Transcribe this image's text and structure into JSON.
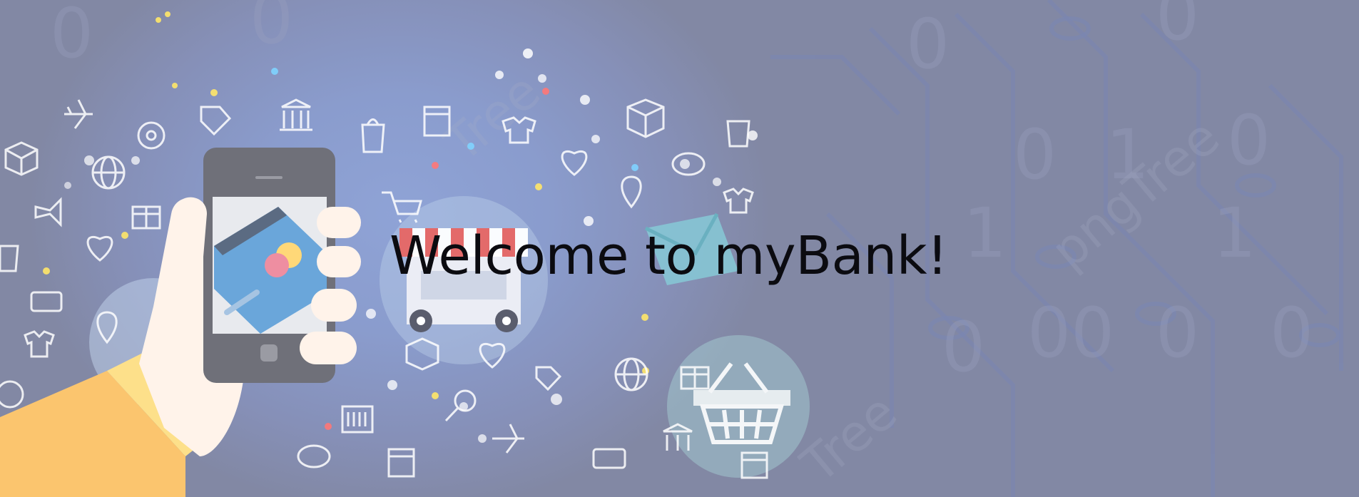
{
  "hero": {
    "heading": "Welcome to myBank!"
  },
  "icons": [
    "phone-in-hand-icon",
    "credit-card-icon",
    "shop-awning-icon",
    "shopping-basket-icon",
    "envelope-icon",
    "gift-icon",
    "globe-icon",
    "heart-icon",
    "airplane-icon",
    "shopping-bag-icon",
    "location-pin-icon",
    "piggy-bank-icon",
    "barcode-icon",
    "tag-icon",
    "bank-building-icon",
    "t-shirt-icon",
    "package-box-icon",
    "megaphone-icon",
    "shopping-cart-icon",
    "magnifier-icon",
    "gear-icon",
    "wallet-icon"
  ],
  "colors": {
    "background": "#8690b8",
    "heading": "#0b0b10",
    "sleeve": "#fbc56e",
    "card": "#6aa6da"
  }
}
